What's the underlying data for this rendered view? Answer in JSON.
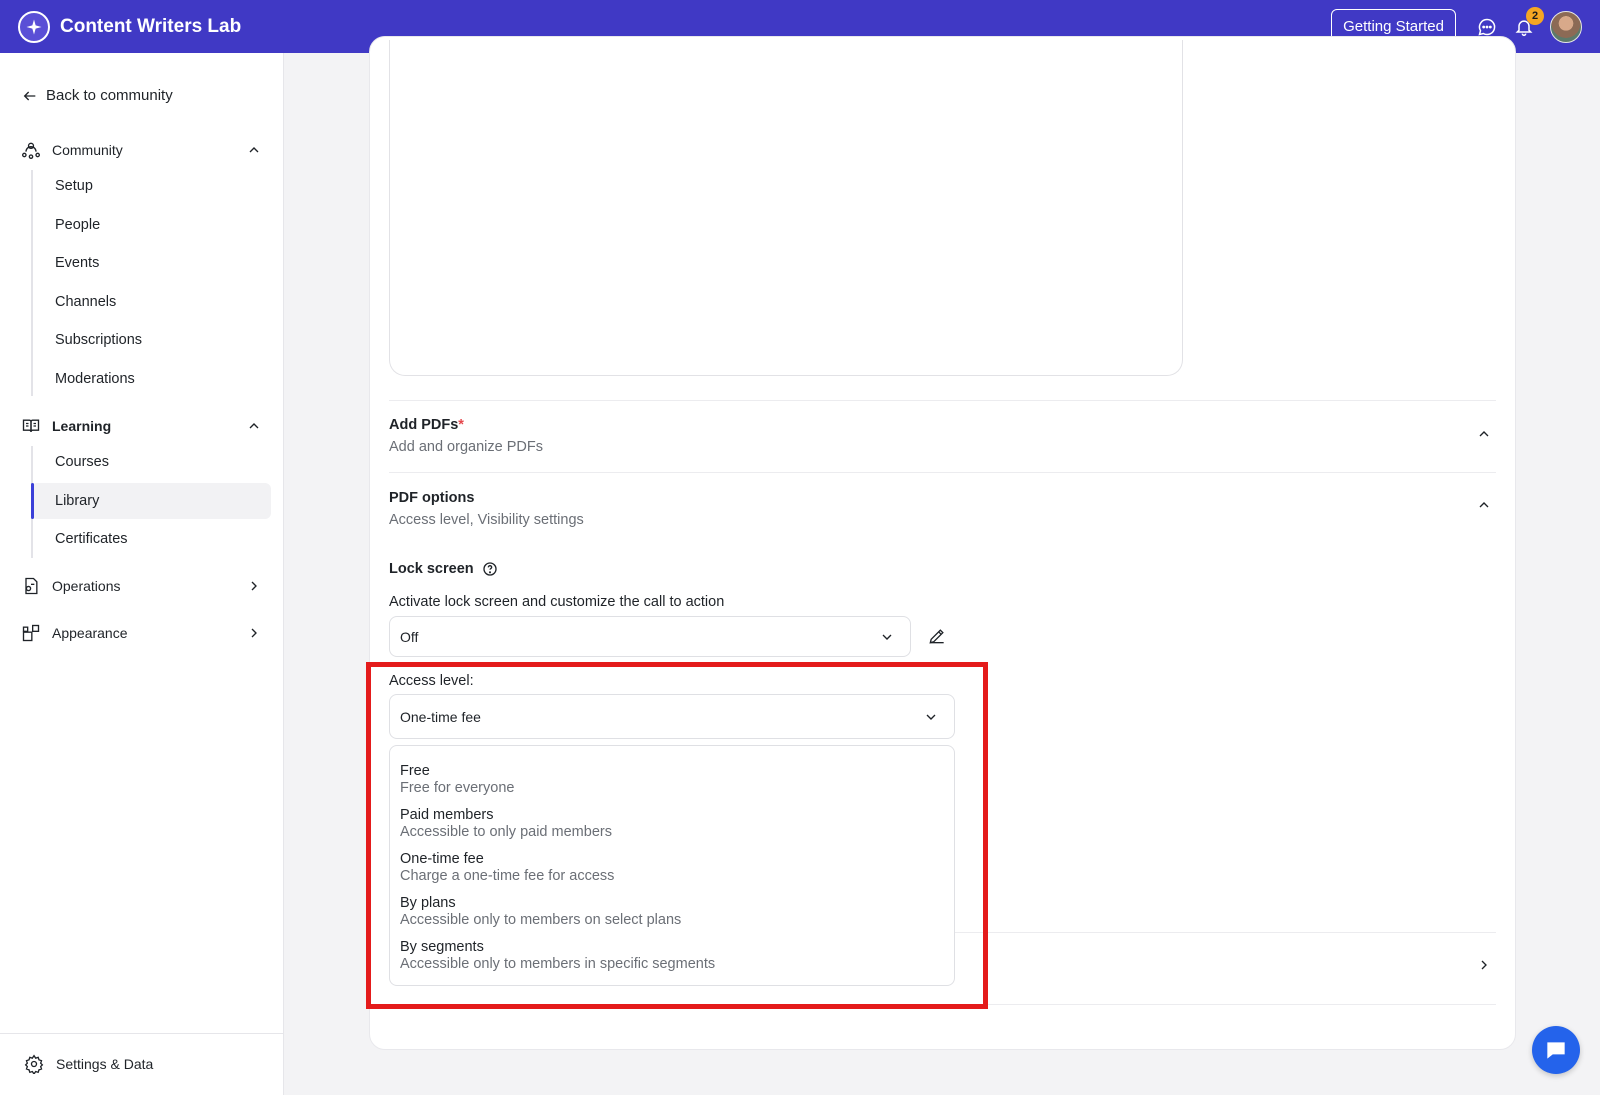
{
  "app": {
    "name": "Content Writers Lab"
  },
  "topbar": {
    "getting_started": "Getting Started",
    "notification_count": "2"
  },
  "sidebar": {
    "back_label": "Back to community",
    "community": {
      "label": "Community",
      "items": [
        "Setup",
        "People",
        "Events",
        "Channels",
        "Subscriptions",
        "Moderations"
      ]
    },
    "learning": {
      "label": "Learning",
      "items": [
        "Courses",
        "Library",
        "Certificates"
      ],
      "active": "Library"
    },
    "operations": {
      "label": "Operations"
    },
    "appearance": {
      "label": "Appearance"
    },
    "settings_label": "Settings & Data"
  },
  "main": {
    "add_pdfs": {
      "title": "Add PDFs",
      "required_mark": "*",
      "subtitle": "Add and organize PDFs"
    },
    "pdf_options": {
      "title": "PDF options",
      "subtitle": "Access level, Visibility settings"
    },
    "lock_screen": {
      "title": "Lock screen",
      "description": "Activate lock screen and customize the call to action",
      "value": "Off"
    },
    "access_level": {
      "label": "Access level:",
      "value": "One-time fee",
      "options": [
        {
          "title": "Free",
          "desc": "Free for everyone"
        },
        {
          "title": "Paid members",
          "desc": "Accessible to only paid members"
        },
        {
          "title": "One-time fee",
          "desc": "Charge a one-time fee for access"
        },
        {
          "title": "By plans",
          "desc": "Accessible only to members on select plans"
        },
        {
          "title": "By segments",
          "desc": "Accessible only to members in specific segments"
        }
      ]
    }
  },
  "colors": {
    "topbar": "#4039c5",
    "accent": "#3b40d8",
    "highlight": "#e41b1b",
    "badge": "#f5a623",
    "chat": "#2463eb"
  }
}
